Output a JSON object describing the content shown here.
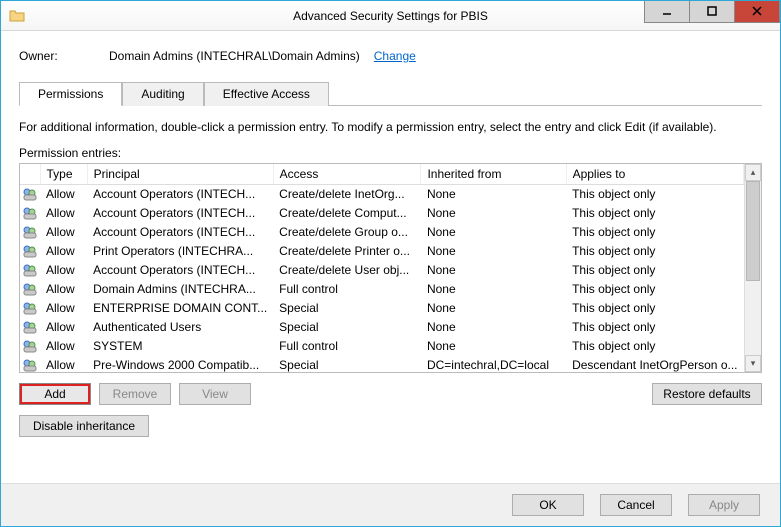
{
  "window": {
    "title": "Advanced Security Settings for PBIS"
  },
  "owner": {
    "label": "Owner:",
    "value": "Domain Admins (INTECHRAL\\Domain Admins)",
    "change_label": "Change"
  },
  "tabs": [
    {
      "label": "Permissions",
      "active": true
    },
    {
      "label": "Auditing",
      "active": false
    },
    {
      "label": "Effective Access",
      "active": false
    }
  ],
  "info_text": "For additional information, double-click a permission entry. To modify a permission entry, select the entry and click Edit (if available).",
  "entries_label": "Permission entries:",
  "columns": {
    "type": "Type",
    "principal": "Principal",
    "access": "Access",
    "inherited": "Inherited from",
    "applies": "Applies to"
  },
  "rows": [
    {
      "type": "Allow",
      "principal": "Account Operators (INTECH...",
      "access": "Create/delete InetOrg...",
      "inherited": "None",
      "applies": "This object only"
    },
    {
      "type": "Allow",
      "principal": "Account Operators (INTECH...",
      "access": "Create/delete Comput...",
      "inherited": "None",
      "applies": "This object only"
    },
    {
      "type": "Allow",
      "principal": "Account Operators (INTECH...",
      "access": "Create/delete Group o...",
      "inherited": "None",
      "applies": "This object only"
    },
    {
      "type": "Allow",
      "principal": "Print Operators (INTECHRA...",
      "access": "Create/delete Printer o...",
      "inherited": "None",
      "applies": "This object only"
    },
    {
      "type": "Allow",
      "principal": "Account Operators (INTECH...",
      "access": "Create/delete User obj...",
      "inherited": "None",
      "applies": "This object only"
    },
    {
      "type": "Allow",
      "principal": "Domain Admins (INTECHRA...",
      "access": "Full control",
      "inherited": "None",
      "applies": "This object only"
    },
    {
      "type": "Allow",
      "principal": "ENTERPRISE DOMAIN CONT...",
      "access": "Special",
      "inherited": "None",
      "applies": "This object only"
    },
    {
      "type": "Allow",
      "principal": "Authenticated Users",
      "access": "Special",
      "inherited": "None",
      "applies": "This object only"
    },
    {
      "type": "Allow",
      "principal": "SYSTEM",
      "access": "Full control",
      "inherited": "None",
      "applies": "This object only"
    },
    {
      "type": "Allow",
      "principal": "Pre-Windows 2000 Compatib...",
      "access": "Special",
      "inherited": "DC=intechral,DC=local",
      "applies": "Descendant InetOrgPerson o..."
    }
  ],
  "buttons": {
    "add": "Add",
    "remove": "Remove",
    "view": "View",
    "restore": "Restore defaults",
    "disable_inherit": "Disable inheritance",
    "ok": "OK",
    "cancel": "Cancel",
    "apply": "Apply"
  }
}
